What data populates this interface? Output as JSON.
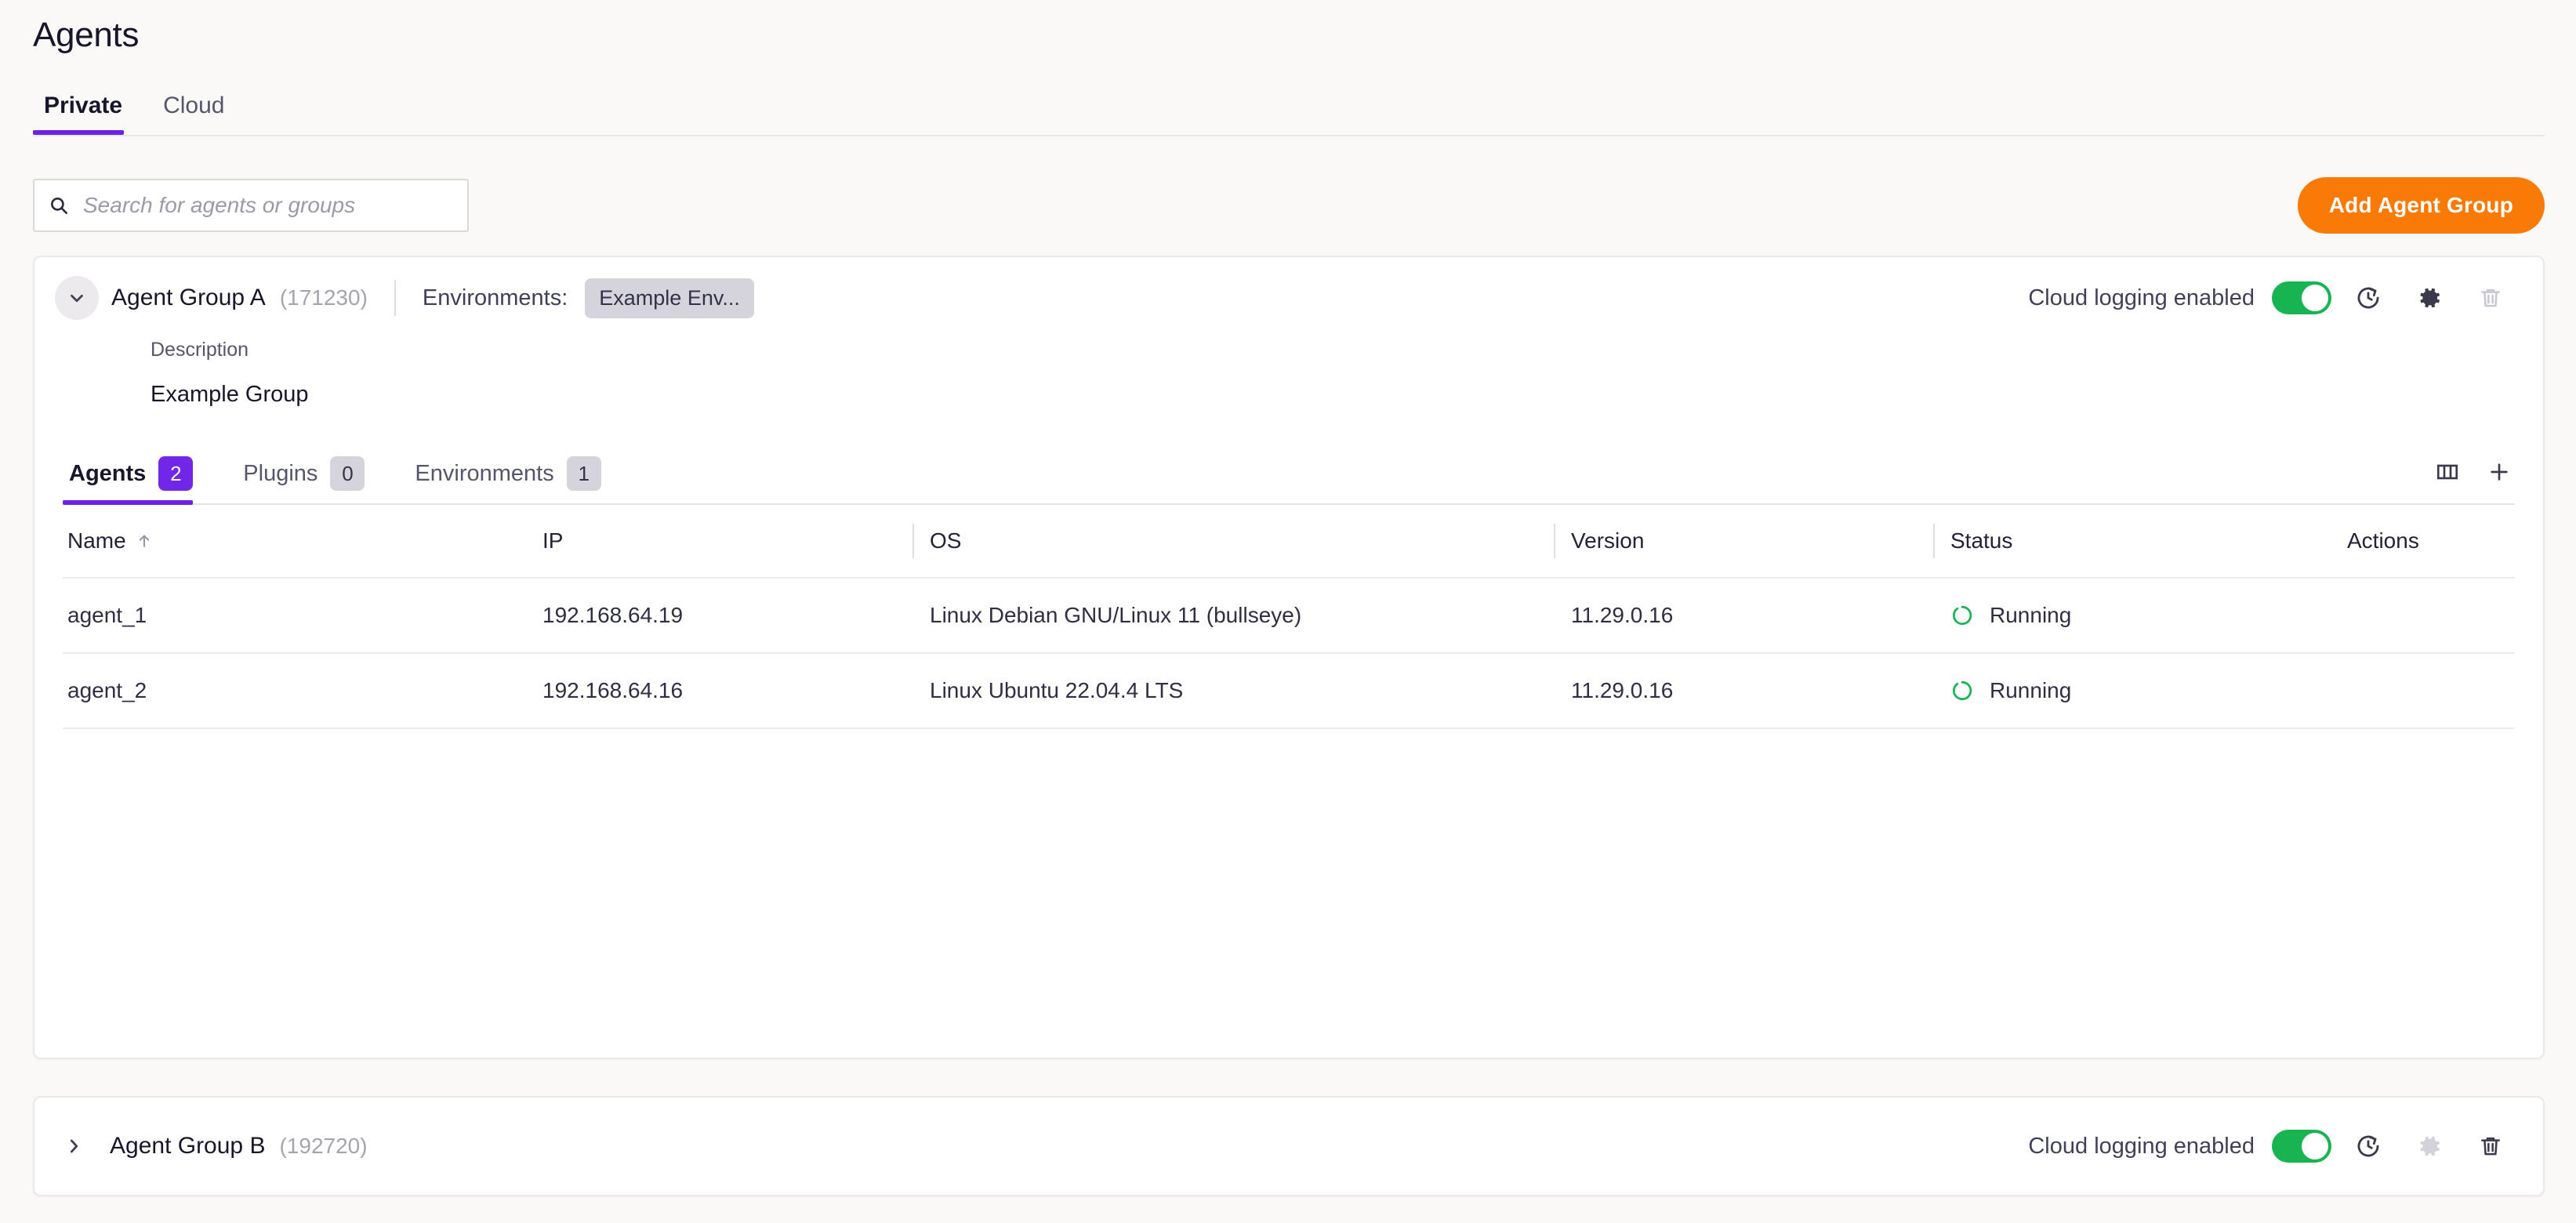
{
  "page": {
    "title": "Agents"
  },
  "top_tabs": [
    {
      "label": "Private",
      "active": true
    },
    {
      "label": "Cloud",
      "active": false
    }
  ],
  "toolbar": {
    "search_placeholder": "Search for agents or groups",
    "search_value": "",
    "search_icon": "search-icon",
    "add_button_label": "Add Agent Group"
  },
  "colors": {
    "accent_purple": "#6b21e8",
    "badge_purple": "#7226e8",
    "orange": "#f97a07",
    "toggle_green": "#17b451",
    "status_green": "#18b455",
    "page_bg": "#faf9f7",
    "card_bg": "#ffffff",
    "chip_grey": "#d5d4dd"
  },
  "groups": [
    {
      "name": "Agent Group A",
      "id": "(171230)",
      "expanded": true,
      "chevron_icon": "chevron-down-icon",
      "environments_label": "Environments:",
      "environment_chip": "Example Env...",
      "cloud_logging_label": "Cloud logging enabled",
      "cloud_logging_on": true,
      "description_label": "Description",
      "description_value": "Example Group",
      "actions": {
        "restore_icon": "history-restore-icon",
        "settings_icon": "gear-icon",
        "delete_icon": "trash-icon",
        "settings_disabled": false,
        "delete_disabled": true
      },
      "tabs": [
        {
          "label": "Agents",
          "count": "2",
          "active": true
        },
        {
          "label": "Plugins",
          "count": "0",
          "active": false
        },
        {
          "label": "Environments",
          "count": "1",
          "active": false
        }
      ],
      "tab_actions": {
        "columns_icon": "columns-icon",
        "add_icon": "plus-icon"
      },
      "table": {
        "columns": [
          {
            "label": "Name",
            "sort": "ascending",
            "sort_icon": "arrow-up-icon"
          },
          {
            "label": "IP"
          },
          {
            "label": "OS"
          },
          {
            "label": "Version"
          },
          {
            "label": "Status"
          },
          {
            "label": "Actions"
          }
        ],
        "rows": [
          {
            "name": "agent_1",
            "ip": "192.168.64.19",
            "os": "Linux Debian GNU/Linux 11 (bullseye)",
            "version": "11.29.0.16",
            "status": "Running",
            "status_icon": "spinner-icon",
            "actions": ""
          },
          {
            "name": "agent_2",
            "ip": "192.168.64.16",
            "os": "Linux Ubuntu 22.04.4 LTS",
            "version": "11.29.0.16",
            "status": "Running",
            "status_icon": "spinner-icon",
            "actions": ""
          }
        ]
      }
    },
    {
      "name": "Agent Group B",
      "id": "(192720)",
      "expanded": false,
      "chevron_icon": "chevron-right-icon",
      "cloud_logging_label": "Cloud logging enabled",
      "cloud_logging_on": true,
      "actions": {
        "restore_icon": "history-restore-icon",
        "settings_icon": "gear-icon",
        "delete_icon": "trash-icon",
        "settings_disabled": true,
        "delete_disabled": false
      }
    }
  ]
}
